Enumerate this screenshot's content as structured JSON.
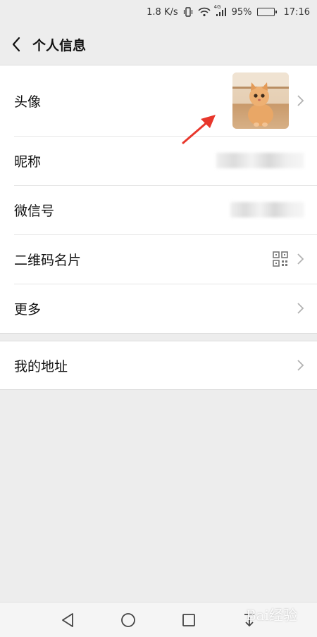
{
  "status_bar": {
    "network_speed": "1.8 K/s",
    "network_type": "4G",
    "battery_percent": "95%",
    "battery_level": 0.95,
    "time": "17:16"
  },
  "nav": {
    "title": "个人信息",
    "back_icon": "chevron-left-icon"
  },
  "profile_items": [
    {
      "label": "头像"
    },
    {
      "label": "昵称"
    },
    {
      "label": "微信号"
    },
    {
      "label": "二维码名片"
    },
    {
      "label": "更多"
    }
  ],
  "address_item": {
    "label": "我的地址"
  },
  "avatar": {
    "subject": "orange kitten photo"
  },
  "annotation": {
    "color": "#e8372c"
  },
  "watermark": "Bai经验"
}
